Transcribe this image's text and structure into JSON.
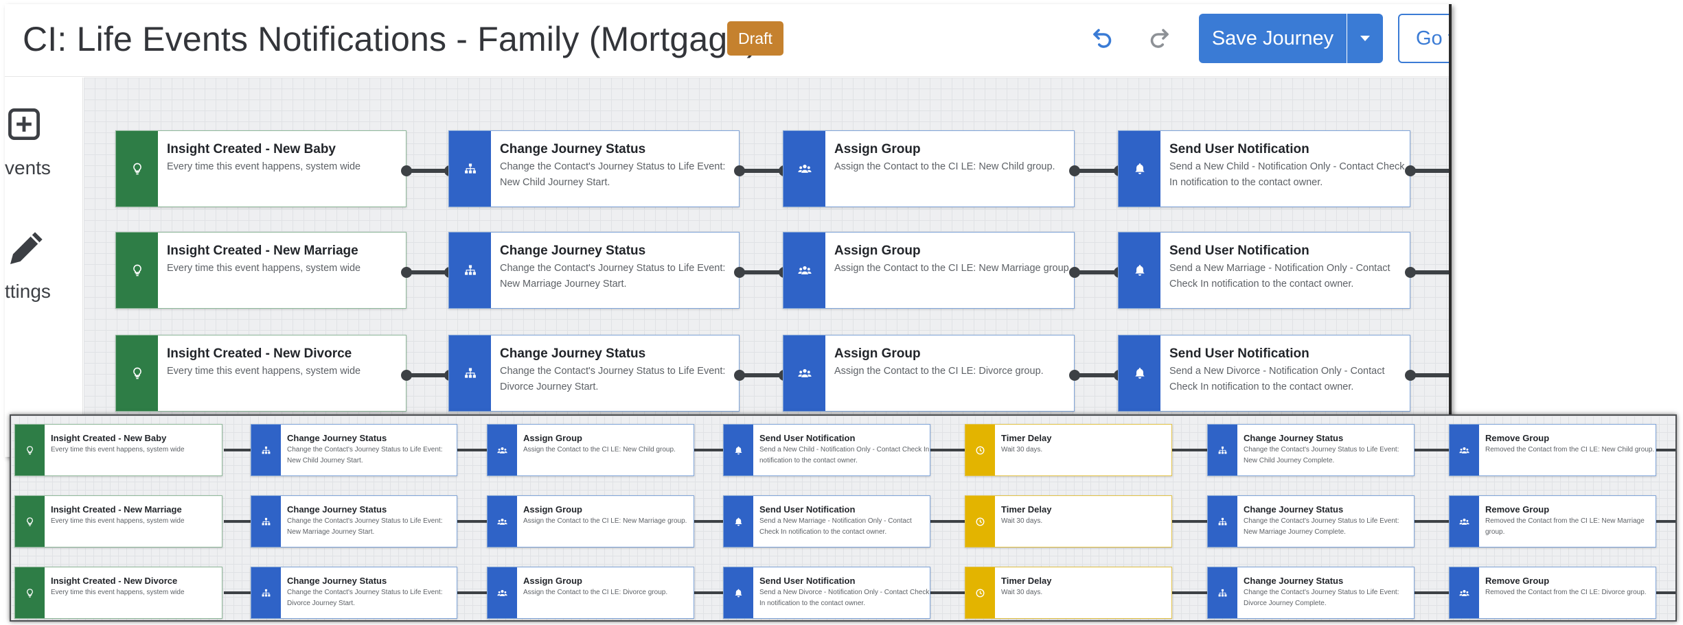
{
  "header": {
    "title": "CI: Life Events Notifications - Family (Mortgage)",
    "status_badge": "Draft",
    "save_label": "Save Journey",
    "goto_label": "Go to"
  },
  "left_panel": {
    "events_label": "vents",
    "settings_label": "ttings"
  },
  "colors": {
    "trigger_green": "#2e7d46",
    "action_blue": "#2f63c7",
    "timer_yellow": "#e3b400",
    "badge_orange": "#c5812e",
    "primary_button": "#3a7bd5"
  },
  "icons": {
    "trigger": "lightbulb-icon",
    "journey_status": "hierarchy-icon",
    "group": "users-icon",
    "notification": "bell-icon",
    "timer": "clock-icon"
  },
  "main_rows": [
    {
      "trigger": {
        "title": "Insight Created - New Baby",
        "desc": "Every time this event happens, system wide"
      },
      "status": {
        "title": "Change Journey Status",
        "desc": "Change the Contact's Journey Status to Life Event: New Child Journey Start."
      },
      "group": {
        "title": "Assign Group",
        "desc": "Assign the Contact to the CI LE: New Child group."
      },
      "notify": {
        "title": "Send User Notification",
        "desc": "Send a New Child - Notification Only - Contact Check In notification to the contact owner."
      }
    },
    {
      "trigger": {
        "title": "Insight Created - New Marriage",
        "desc": "Every time this event happens, system wide"
      },
      "status": {
        "title": "Change Journey Status",
        "desc": "Change the Contact's Journey Status to Life Event: New Marriage Journey Start."
      },
      "group": {
        "title": "Assign Group",
        "desc": "Assign the Contact to the CI LE: New Marriage group."
      },
      "notify": {
        "title": "Send User Notification",
        "desc": "Send a New Marriage - Notification Only - Contact Check In notification to the contact owner."
      }
    },
    {
      "trigger": {
        "title": "Insight Created - New Divorce",
        "desc": "Every time this event happens, system wide"
      },
      "status": {
        "title": "Change Journey Status",
        "desc": "Change the Contact's Journey Status to Life Event: Divorce Journey Start."
      },
      "group": {
        "title": "Assign Group",
        "desc": "Assign the Contact to the CI LE: Divorce group."
      },
      "notify": {
        "title": "Send User Notification",
        "desc": "Send a New Divorce - Notification Only - Contact Check In notification to the contact owner."
      }
    }
  ],
  "inset_rows": [
    {
      "trigger": {
        "title": "Insight Created - New Baby",
        "desc": "Every time this event happens, system wide"
      },
      "status": {
        "title": "Change Journey Status",
        "desc": "Change the Contact's Journey Status to Life Event: New Child Journey Start."
      },
      "group": {
        "title": "Assign Group",
        "desc": "Assign the Contact to the CI LE: New Child group."
      },
      "notify": {
        "title": "Send User Notification",
        "desc": "Send a New Child - Notification Only - Contact Check In notification to the contact owner."
      },
      "timer": {
        "title": "Timer Delay",
        "desc": "Wait 30 days."
      },
      "status2": {
        "title": "Change Journey Status",
        "desc": "Change the Contact's Journey Status to Life Event: New Child Journey Complete."
      },
      "remove": {
        "title": "Remove Group",
        "desc": "Removed the Contact from the CI LE: New Child group."
      }
    },
    {
      "trigger": {
        "title": "Insight Created - New Marriage",
        "desc": "Every time this event happens, system wide"
      },
      "status": {
        "title": "Change Journey Status",
        "desc": "Change the Contact's Journey Status to Life Event: New Marriage Journey Start."
      },
      "group": {
        "title": "Assign Group",
        "desc": "Assign the Contact to the CI LE: New Marriage group."
      },
      "notify": {
        "title": "Send User Notification",
        "desc": "Send a New Marriage - Notification Only - Contact Check In notification to the contact owner."
      },
      "timer": {
        "title": "Timer Delay",
        "desc": "Wait 30 days."
      },
      "status2": {
        "title": "Change Journey Status",
        "desc": "Change the Contact's Journey Status to Life Event: New Marriage Journey Complete."
      },
      "remove": {
        "title": "Remove Group",
        "desc": "Removed the Contact from the CI LE: New Marriage group."
      }
    },
    {
      "trigger": {
        "title": "Insight Created - New Divorce",
        "desc": "Every time this event happens, system wide"
      },
      "status": {
        "title": "Change Journey Status",
        "desc": "Change the Contact's Journey Status to Life Event: Divorce Journey Start."
      },
      "group": {
        "title": "Assign Group",
        "desc": "Assign the Contact to the CI LE: Divorce group."
      },
      "notify": {
        "title": "Send User Notification",
        "desc": "Send a New Divorce - Notification Only - Contact Check In notification to the contact owner."
      },
      "timer": {
        "title": "Timer Delay",
        "desc": "Wait 30 days."
      },
      "status2": {
        "title": "Change Journey Status",
        "desc": "Change the Contact's Journey Status to Life Event: Divorce Journey Complete."
      },
      "remove": {
        "title": "Remove Group",
        "desc": "Removed the Contact from the CI LE: Divorce group."
      }
    }
  ]
}
